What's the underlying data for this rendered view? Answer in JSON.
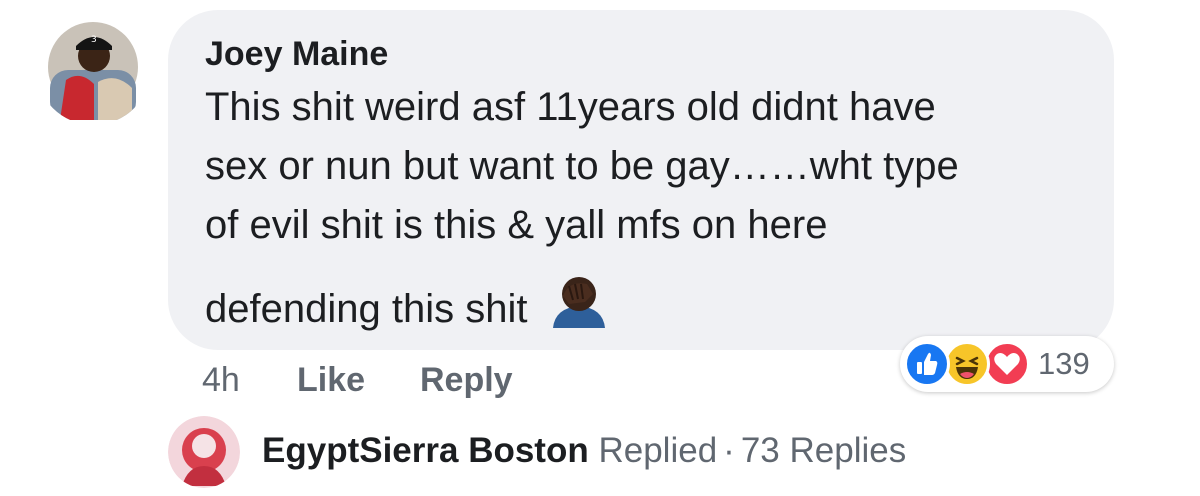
{
  "comment": {
    "author": "Joey Maine",
    "lines": [
      "This shit weird asf 11years old didnt have",
      "sex or nun but want to be gay……wht type",
      "of evil shit is this & yall mfs on here",
      "defending this shit"
    ],
    "emoji": "face-palm-emoji",
    "time": "4h",
    "like_label": "Like",
    "reply_label": "Reply",
    "reactions": {
      "icons": [
        "like-reaction-icon",
        "haha-reaction-icon",
        "love-reaction-icon"
      ],
      "count": "139"
    }
  },
  "replies": {
    "name": "EgyptSierra Boston",
    "action": "Replied",
    "separator": "·",
    "count_label": "73 Replies"
  },
  "colors": {
    "bubble": "#f0f1f4",
    "text": "#1c1e21",
    "meta": "#606770",
    "like_blue": "#1877f2",
    "haha_yellow": "#f7c529",
    "love_red": "#f23d53"
  }
}
